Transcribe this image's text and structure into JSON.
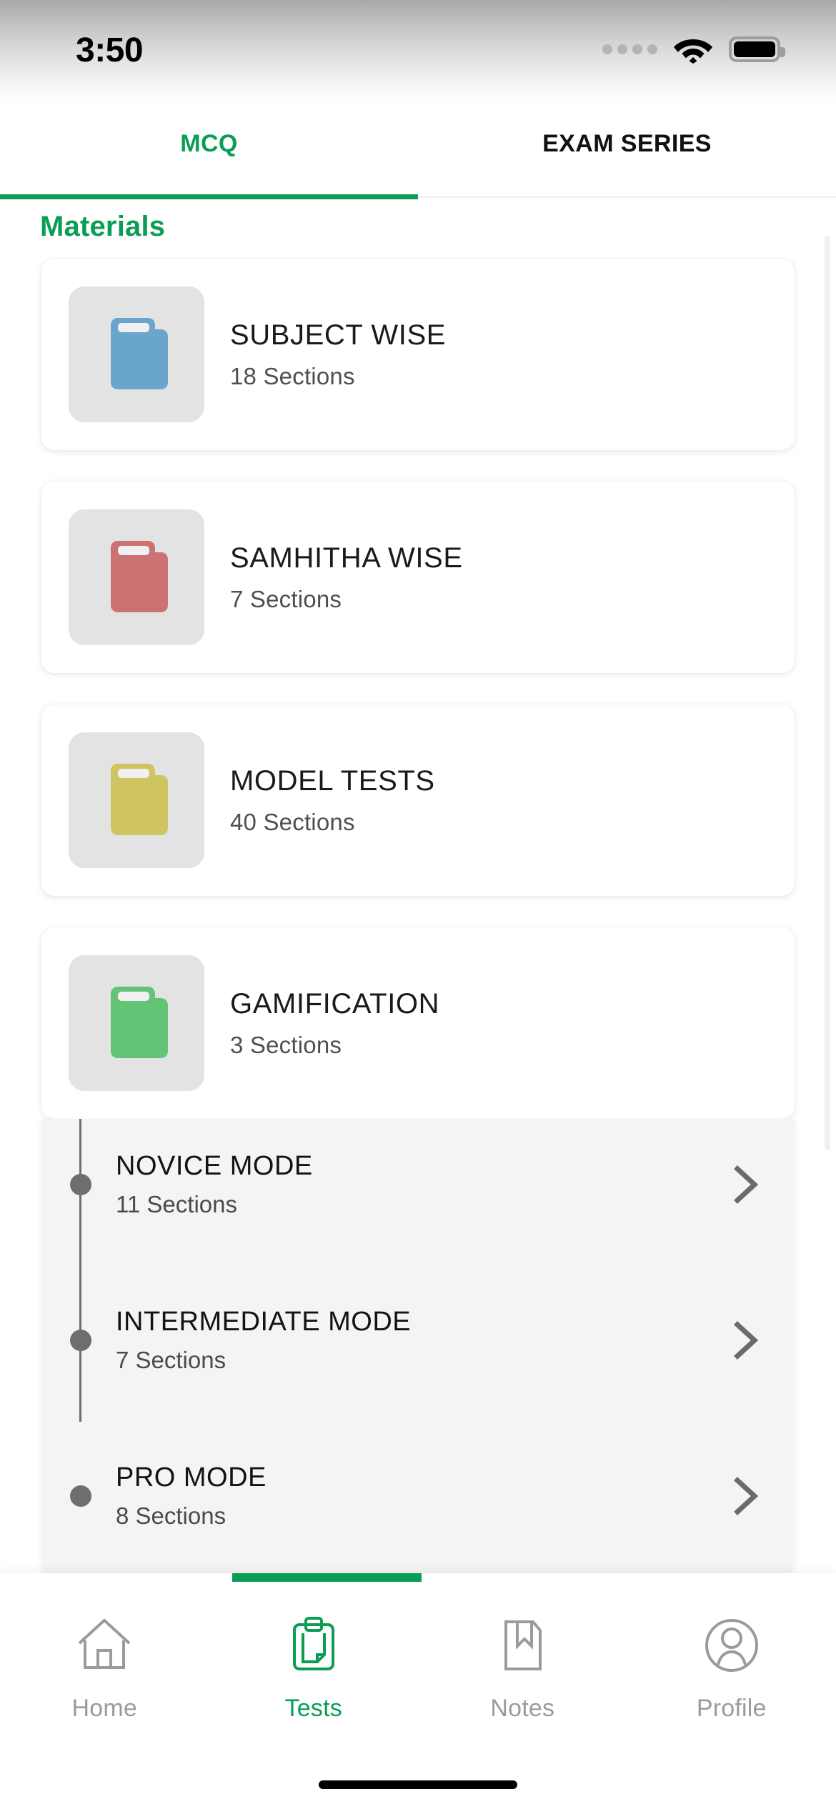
{
  "status_bar": {
    "time": "3:50",
    "signal_icon": "signal-dots-icon",
    "wifi_icon": "wifi-icon",
    "battery_icon": "battery-full-icon"
  },
  "top_tabs": {
    "items": [
      {
        "label": "MCQ",
        "active": true
      },
      {
        "label": "EXAM SERIES",
        "active": false
      }
    ],
    "accent_color": "#0a9d55"
  },
  "main": {
    "section_title": "Materials",
    "cards": [
      {
        "title": "SUBJECT WISE",
        "subtitle": "18 Sections",
        "icon": "book-icon",
        "icon_color": "#6aa5cc",
        "expanded": false
      },
      {
        "title": "SAMHITHA WISE",
        "subtitle": "7 Sections",
        "icon": "book-icon",
        "icon_color": "#cd7272",
        "expanded": false
      },
      {
        "title": "MODEL TESTS",
        "subtitle": "40 Sections",
        "icon": "book-icon",
        "icon_color": "#cfc45f",
        "expanded": false
      },
      {
        "title": "GAMIFICATION",
        "subtitle": "3 Sections",
        "icon": "book-icon",
        "icon_color": "#63c476",
        "expanded": true,
        "sub_items": [
          {
            "title": "NOVICE MODE",
            "subtitle": "11 Sections",
            "chevron": "chevron-right-icon"
          },
          {
            "title": "INTERMEDIATE MODE",
            "subtitle": "7 Sections",
            "chevron": "chevron-right-icon"
          },
          {
            "title": "PRO MODE",
            "subtitle": "8 Sections",
            "chevron": "chevron-right-icon"
          }
        ]
      }
    ]
  },
  "bottom_nav": {
    "items": [
      {
        "label": "Home",
        "icon": "home-icon",
        "active": false
      },
      {
        "label": "Tests",
        "icon": "clipboard-icon",
        "active": true
      },
      {
        "label": "Notes",
        "icon": "bookmark-note-icon",
        "active": false
      },
      {
        "label": "Profile",
        "icon": "person-circle-icon",
        "active": false
      }
    ],
    "accent_color": "#0a9d55",
    "inactive_color": "#9b9b9b"
  }
}
